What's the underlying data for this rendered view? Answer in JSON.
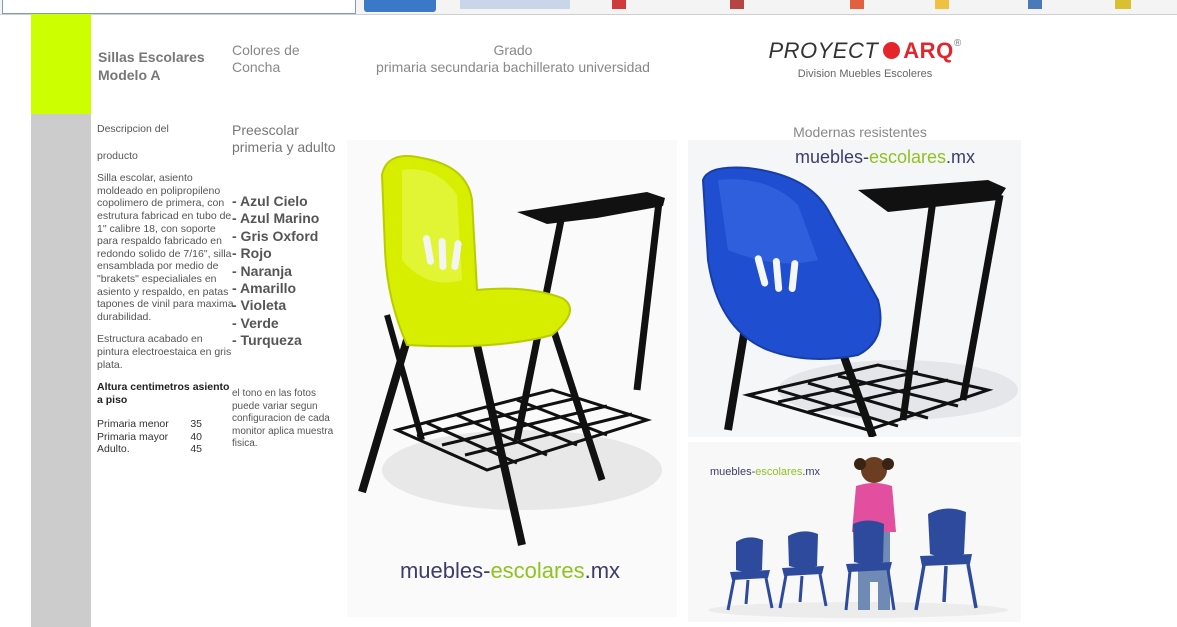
{
  "header": {
    "title": "Sillas Escolares Modelo A",
    "colores": "Colores de Concha",
    "grado_title": "Grado",
    "grado_levels": "primaria secundaria bachillerato universidad"
  },
  "logo": {
    "main": "PROYECT",
    "accent": "ARQ",
    "reg": "®",
    "sub": "Division Muebles Escoleres"
  },
  "description": {
    "heading1": "Descripcion del",
    "heading2": "producto",
    "body": "Silla escolar, asiento moldeado en polipropileno copolimero de primera, con estrutura fabricad en tubo de 1\" calibre 18, con soporte para respaldo fabricado en redondo solido de 7/16\", silla ensamblada por medio de \"brakets\" especialiales en asiento y respaldo, en patas tapones de vinil para maxima durabilidad.",
    "structure": "Estructura acabado en pintura electroestaica en gris plata.",
    "height_title": "Altura centimetros asiento a piso",
    "heights": [
      {
        "label": "Primaria menor",
        "value": "35"
      },
      {
        "label": "Primaria mayor",
        "value": "40"
      },
      {
        "label": "Adulto.",
        "value": "45"
      }
    ]
  },
  "levels_text": "Preescolar primeria y adulto",
  "colors": [
    "- Azul Cielo",
    "- Azul Marino",
    "- Gris Oxford",
    "- Rojo",
    "- Naranja",
    "- Amarillo",
    "- Violeta",
    "- Verde",
    "- Turqueza"
  ],
  "note": "el tono en las fotos puede variar segun configuracion de cada monitor aplica muestra fisica.",
  "right": {
    "modernas": "Modernas resistentes"
  },
  "brand": {
    "part1": "muebles-",
    "part2": "escolares",
    "part3": ".mx"
  },
  "palette": {
    "green_block": "#ccff00",
    "gray_strip": "#cccccc",
    "logo_red": "#e4262c",
    "brand_navy": "#3b3d6a",
    "brand_green": "#8fc31f",
    "chair_yellow": "#d8ee00",
    "chair_blue": "#1f4fd0"
  }
}
